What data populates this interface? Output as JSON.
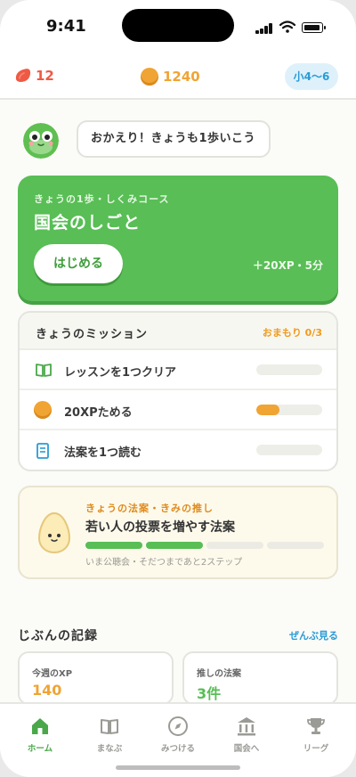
{
  "status": {
    "time": "9:41"
  },
  "topbar": {
    "streak": "12",
    "coins": "1240",
    "grade": "小4〜6"
  },
  "greeting": {
    "text": "おかえり！きょうも1歩いこう"
  },
  "lesson": {
    "kicker": "きょうの1歩・しくみコース",
    "title": "国会のしごと",
    "start_label": "はじめる",
    "reward": "＋20XP・5分"
  },
  "missions": {
    "title": "きょうのミッション",
    "amulet": "おまもり 0/3",
    "items": [
      {
        "label": "レッスンを1つクリア",
        "icon": "book-icon",
        "progress": 0
      },
      {
        "label": "20XPためる",
        "icon": "coin-icon",
        "progress": 0.35
      },
      {
        "label": "法案を1つ読む",
        "icon": "document-icon",
        "progress": 0
      }
    ]
  },
  "bill": {
    "kicker": "きょうの法案・きみの推し",
    "title": "若い人の投票を増やす法案",
    "steps_done": 2,
    "steps_total": 4,
    "note": "いま公聴会・そだつまであと2ステップ"
  },
  "records": {
    "title": "じぶんの記録",
    "see_all": "ぜんぶ見る",
    "cards": [
      {
        "label": "今週のXP",
        "value": "140"
      },
      {
        "label": "推しの法案",
        "value": "3件"
      }
    ]
  },
  "tabs": [
    {
      "label": "ホーム",
      "icon": "home-icon",
      "active": true
    },
    {
      "label": "まなぶ",
      "icon": "book-icon",
      "active": false
    },
    {
      "label": "みつける",
      "icon": "compass-icon",
      "active": false
    },
    {
      "label": "国会へ",
      "icon": "parliament-icon",
      "active": false
    },
    {
      "label": "リーグ",
      "icon": "trophy-icon",
      "active": false
    }
  ],
  "colors": {
    "brand_green": "#58be55",
    "coin_orange": "#f0a433",
    "accent_blue": "#2a9bd6",
    "streak_red": "#ef5a45"
  }
}
